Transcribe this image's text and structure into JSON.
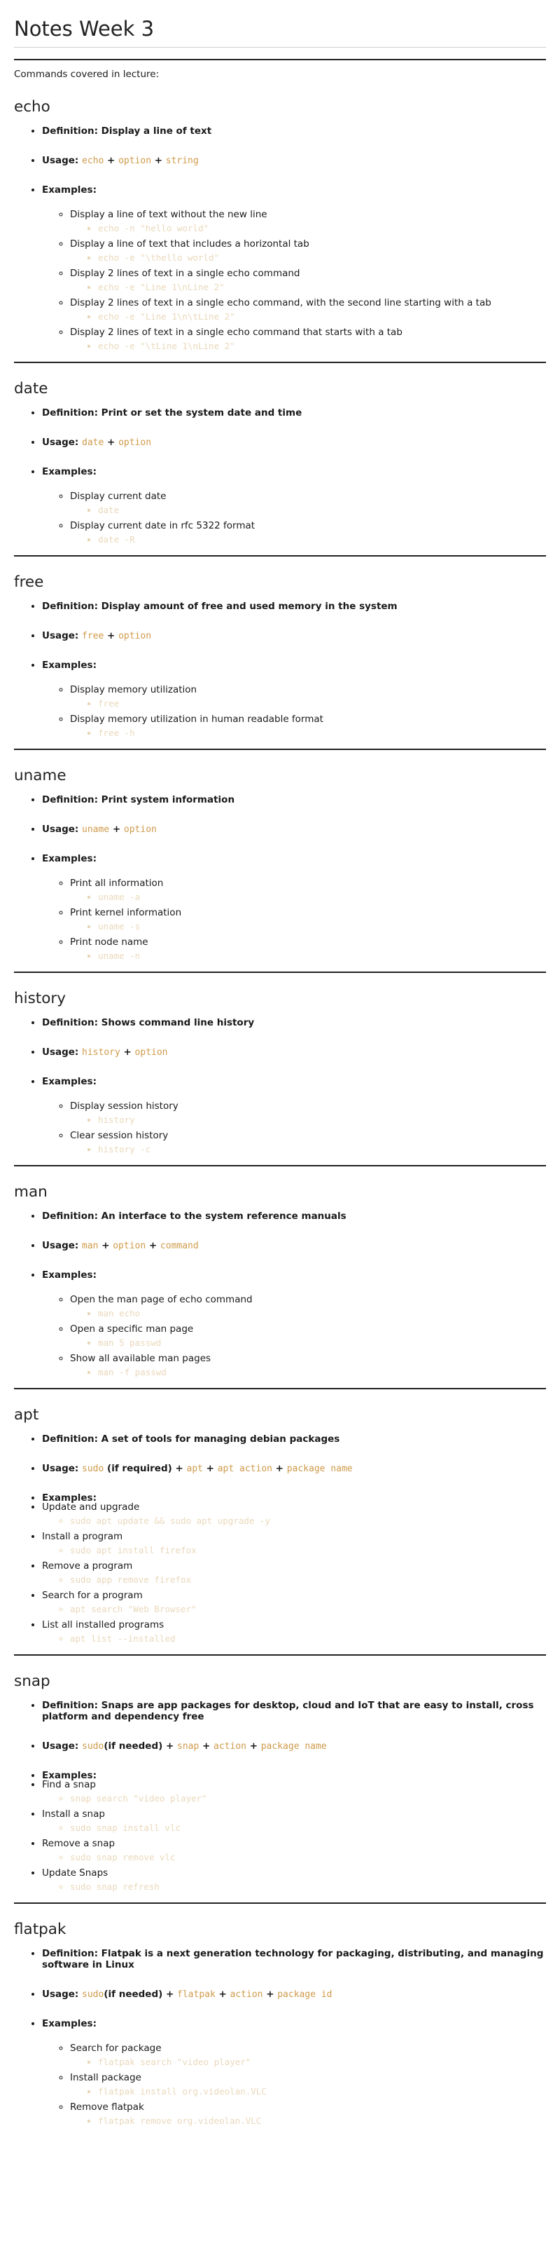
{
  "title": "Notes Week 3",
  "intro": "Commands covered in lecture:",
  "labels": {
    "definition": "Definition:",
    "usage": "Usage:",
    "examples": "Examples:",
    "plus": " + "
  },
  "sections": [
    {
      "name": "echo",
      "definition": "Display a line of text",
      "usage": [
        [
          "c",
          "echo"
        ],
        [
          "t",
          " + "
        ],
        [
          "c",
          "option"
        ],
        [
          "t",
          " + "
        ],
        [
          "c",
          "string"
        ]
      ],
      "style": "nested",
      "examples": [
        {
          "desc": "Display a line of text without the new line",
          "cmd": "echo -n \"hello world\""
        },
        {
          "desc": "Display a line of text that includes a horizontal tab",
          "cmd": "echo -e \"\\thello world\""
        },
        {
          "desc": "Display 2 lines of text in a single echo command",
          "cmd": "echo -e \"Line 1\\nLine 2\""
        },
        {
          "desc": "Display 2 lines of text in a single echo command, with the second line starting with a tab",
          "cmd": "echo -e \"Line 1\\n\\tLine 2\""
        },
        {
          "desc": "Display 2 lines of text in a single echo command that starts with a tab",
          "cmd": "echo -e \"\\tLine 1\\nLine 2\""
        }
      ]
    },
    {
      "name": "date",
      "definition": "Print or set the system date and time",
      "usage": [
        [
          "c",
          "date"
        ],
        [
          "t",
          " + "
        ],
        [
          "c",
          "option"
        ]
      ],
      "style": "nested",
      "examples": [
        {
          "desc": "Display current date",
          "cmd": "date"
        },
        {
          "desc": "Display current date in rfc 5322 format",
          "cmd": "date -R"
        }
      ]
    },
    {
      "name": "free",
      "definition": "Display amount of free and used memory in the system",
      "usage": [
        [
          "c",
          "free"
        ],
        [
          "t",
          " + "
        ],
        [
          "c",
          "option"
        ]
      ],
      "style": "nested",
      "examples": [
        {
          "desc": "Display memory utilization",
          "cmd": "free"
        },
        {
          "desc": "Display memory utilization in human readable format",
          "cmd": "free -h"
        }
      ]
    },
    {
      "name": "uname",
      "definition": "Print system information",
      "usage": [
        [
          "c",
          "uname"
        ],
        [
          "t",
          " + "
        ],
        [
          "c",
          "option"
        ]
      ],
      "style": "nested",
      "examples": [
        {
          "desc": "Print all information",
          "cmd": "uname -a"
        },
        {
          "desc": "Print kernel information",
          "cmd": "uname -s"
        },
        {
          "desc": "Print node name",
          "cmd": "uname -n"
        }
      ]
    },
    {
      "name": "history",
      "definition": "Shows command line history",
      "usage": [
        [
          "c",
          "history"
        ],
        [
          "t",
          " + "
        ],
        [
          "c",
          "option"
        ]
      ],
      "style": "nested",
      "examples": [
        {
          "desc": "Display session history",
          "cmd": "history"
        },
        {
          "desc": "Clear session history",
          "cmd": "history -c"
        }
      ]
    },
    {
      "name": "man",
      "definition": "An interface to the system reference manuals",
      "usage": [
        [
          "c",
          "man"
        ],
        [
          "t",
          " + "
        ],
        [
          "c",
          "option"
        ],
        [
          "t",
          " + "
        ],
        [
          "c",
          "command"
        ]
      ],
      "style": "nested",
      "examples": [
        {
          "desc": "Open the man page of echo command",
          "cmd": "man echo"
        },
        {
          "desc": "Open a specific man page",
          "cmd": "man 5 passwd"
        },
        {
          "desc": "Show all available man pages",
          "cmd": "man -f passwd"
        }
      ]
    },
    {
      "name": "apt",
      "definition": "A set of tools for managing debian packages",
      "usage": [
        [
          "c",
          "sudo"
        ],
        [
          "t",
          " (if required) + "
        ],
        [
          "c",
          "apt"
        ],
        [
          "t",
          " + "
        ],
        [
          "c",
          "apt action"
        ],
        [
          "t",
          " + "
        ],
        [
          "c",
          "package name"
        ]
      ],
      "style": "flat",
      "examples": [
        {
          "desc": "Update and upgrade",
          "cmd": "sudo apt update && sudo apt upgrade -y"
        },
        {
          "desc": "Install a program",
          "cmd": "sudo apt install firefox"
        },
        {
          "desc": "Remove a program",
          "cmd": "sudo app remove firefox"
        },
        {
          "desc": "Search for a program",
          "cmd": "apt search \"Web Browser\""
        },
        {
          "desc": "List all installed programs",
          "cmd": "apt list --installed"
        }
      ]
    },
    {
      "name": "snap",
      "definition": "Snaps are app packages for desktop, cloud and IoT that are easy to install, cross platform and dependency free",
      "usage": [
        [
          "c",
          "sudo"
        ],
        [
          "t",
          "(if needed) + "
        ],
        [
          "c",
          "snap"
        ],
        [
          "t",
          " + "
        ],
        [
          "c",
          "action"
        ],
        [
          "t",
          " + "
        ],
        [
          "c",
          "package name"
        ]
      ],
      "style": "flat",
      "examples": [
        {
          "desc": "Find a snap",
          "cmd": "snap search \"video player\""
        },
        {
          "desc": "Install a snap",
          "cmd": "sudo snap install vlc"
        },
        {
          "desc": "Remove a snap",
          "cmd": "sudo snap remove vlc"
        },
        {
          "desc": "Update Snaps",
          "cmd": "sudo snap refresh"
        }
      ]
    },
    {
      "name": "flatpak",
      "definition": "Flatpak is a next generation technology for packaging, distributing, and managing software in Linux",
      "usage": [
        [
          "c",
          "sudo"
        ],
        [
          "t",
          "(if needed) + "
        ],
        [
          "c",
          "flatpak"
        ],
        [
          "t",
          " + "
        ],
        [
          "c",
          "action"
        ],
        [
          "t",
          " + "
        ],
        [
          "c",
          "package id"
        ]
      ],
      "style": "nested",
      "examples": [
        {
          "desc": "Search for package",
          "cmd": "flatpak search \"video player\""
        },
        {
          "desc": "Install package",
          "cmd": "flatpak install org.videolan.VLC"
        },
        {
          "desc": "Remove flatpak",
          "cmd": "flatpak remove org.videolan.VLC"
        }
      ]
    }
  ]
}
